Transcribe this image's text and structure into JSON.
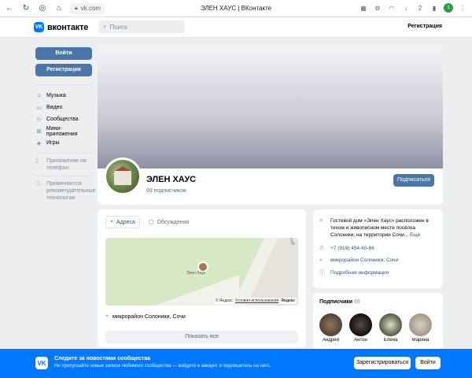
{
  "browser": {
    "url": "vk.com",
    "title": "ЭЛЕН ХАУС | ВКонтакте",
    "icons": [
      "back-icon",
      "refresh-icon",
      "account-icon",
      "home-icon",
      "lock-icon"
    ],
    "badge_number": "2"
  },
  "header": {
    "logo_text": "вконтакте",
    "search_placeholder": "Поиск",
    "register_label": "Регистрация"
  },
  "left": {
    "login_button": "Войти",
    "register_button": "Регистрация",
    "menu": [
      {
        "label": "Музыка",
        "icon": "music-icon"
      },
      {
        "label": "Видео",
        "icon": "video-icon"
      },
      {
        "label": "Сообщества",
        "icon": "community-icon"
      },
      {
        "label": "Мини-приложения",
        "icon": "apps-icon"
      },
      {
        "label": "Игры",
        "icon": "games-icon"
      }
    ],
    "notes": [
      {
        "text": "Приложение на телефон",
        "icon": "phone-icon"
      },
      {
        "text": "Применяются рекомендательные технологии",
        "icon": "info-icon"
      }
    ]
  },
  "profile": {
    "name": "ЭЛЕН ХАУС",
    "subscribers": "69 подписчиков",
    "subscribe_button": "Подписаться"
  },
  "main": {
    "tabs": [
      {
        "label": "Адреса",
        "active": true
      },
      {
        "label": "Обсуждения",
        "active": false
      }
    ],
    "map": {
      "place_label": "Элен Хаус",
      "street_label": "Тенистый",
      "footer_brand": "© Яндекс",
      "footer_terms": "Условия использования",
      "footer_logo": "Яндекс"
    },
    "address": "микрорайон Солоники, Сочи",
    "show_all": "Показать все"
  },
  "info": {
    "description": "Гостевой дом «Элен Хаус» расположен в тихом и живописном месте посёлка Солоники, на территории Сочи...",
    "more": "Ещё",
    "phone": "+7 (919) 454-60-66",
    "address": "микрорайон Солоники, Сочи",
    "details": "Подробная информация"
  },
  "subscribers": {
    "title": "Подписчики",
    "count": "69",
    "people": [
      {
        "name": "Андрей",
        "color": "#6b5a4a"
      },
      {
        "name": "Антон",
        "color": "#2a2a2a"
      },
      {
        "name": "Елена",
        "color": "#5c6b46"
      },
      {
        "name": "Марина",
        "color": "#b7b0a0"
      }
    ]
  },
  "banner": {
    "title": "Следите за новостями сообщества",
    "text": "Не пропускайте новые записи любимого сообщества — войдите в аккаунт и подпишитесь на него.",
    "register_button": "Зарегистрироваться",
    "login_button": "Войти"
  },
  "colors": {
    "vk_blue": "#0077ff",
    "button_blue": "#4a76a8",
    "link_blue": "#2a5885",
    "page_bg": "#edeef0"
  }
}
